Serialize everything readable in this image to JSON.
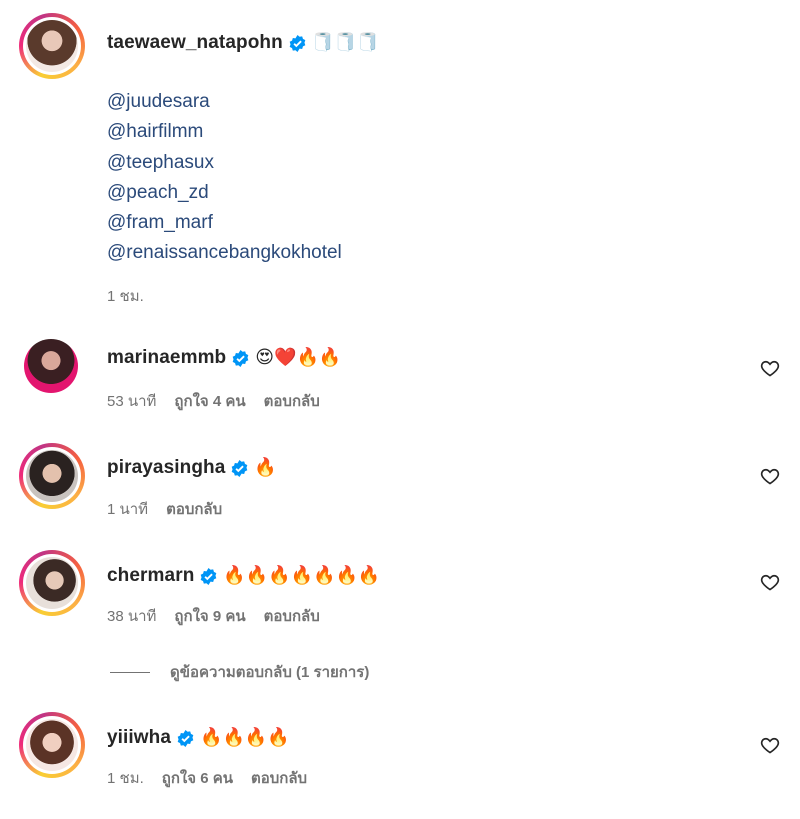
{
  "post": {
    "author": "taewaew_natapohn",
    "author_emoji": "🧻🧻🧻",
    "mentions": [
      "@juudesara",
      "@hairfilmm",
      "@teephasux",
      "@peach_zd",
      "@fram_marf",
      "@renaissancebangkokhotel"
    ],
    "time": "1 ชม."
  },
  "comments": [
    {
      "username": "marinaemmb",
      "text": "😍❤️🔥🔥",
      "time": "53 นาที",
      "likes": "ถูกใจ 4 คน",
      "reply": "ตอบกลับ"
    },
    {
      "username": "pirayasingha",
      "text": "🔥",
      "time": "1 นาที",
      "likes": "",
      "reply": "ตอบกลับ"
    },
    {
      "username": "chermarn",
      "text": "🔥🔥🔥🔥🔥🔥🔥",
      "time": "38 นาที",
      "likes": "ถูกใจ 9 คน",
      "reply": "ตอบกลับ"
    },
    {
      "username": "yiiiwha",
      "text": "🔥🔥🔥🔥",
      "time": "1 ชม.",
      "likes": "ถูกใจ 6 คน",
      "reply": "ตอบกลับ"
    }
  ],
  "view_replies": "ดูข้อความตอบกลับ (1 รายการ)",
  "colors": {
    "verified": "#0095f6",
    "mention": "#2b4a7a",
    "muted": "#737373"
  }
}
